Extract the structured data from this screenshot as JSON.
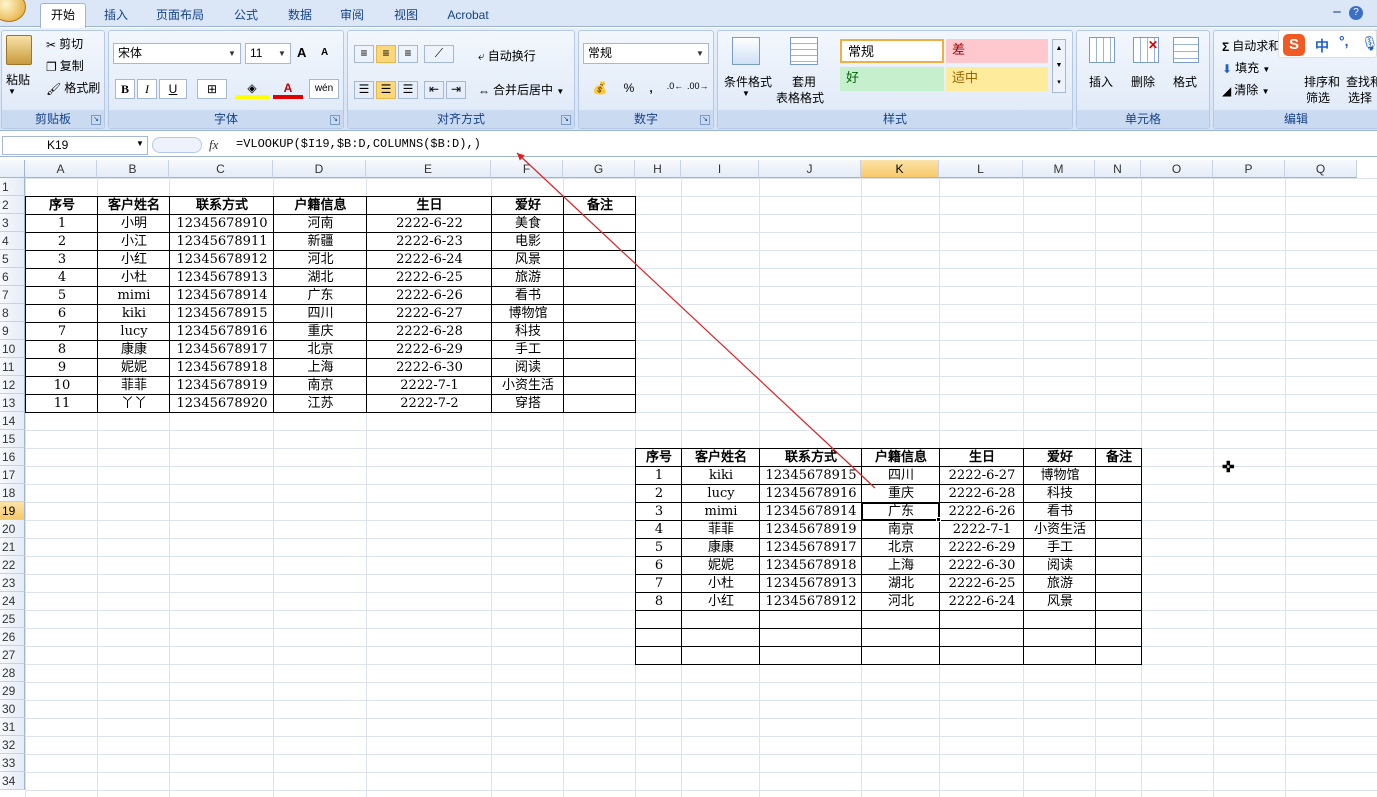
{
  "tabs": [
    "开始",
    "插入",
    "页面布局",
    "公式",
    "数据",
    "审阅",
    "视图",
    "Acrobat"
  ],
  "clipboard": {
    "paste": "粘贴",
    "cut": "剪切",
    "copy": "复制",
    "format_painter": "格式刷",
    "label": "剪贴板"
  },
  "font": {
    "name": "宋体",
    "size": "11",
    "bold": "B",
    "italic": "I",
    "underline": "U",
    "label": "字体",
    "inc": "A",
    "dec": "A",
    "pinyin": "wén"
  },
  "align": {
    "wrap": "自动换行",
    "merge": "合并后居中",
    "label": "对齐方式"
  },
  "number": {
    "format": "常规",
    "percent": "%",
    "comma": ",",
    "label": "数字"
  },
  "styles": {
    "cond": "条件格式",
    "table_fmt1": "套用",
    "table_fmt2": "表格格式",
    "normal": "常规",
    "bad": "差",
    "good": "好",
    "neutral": "适中",
    "label": "样式"
  },
  "cells": {
    "insert": "插入",
    "delete": "删除",
    "format": "格式",
    "label": "单元格"
  },
  "edit": {
    "autosum": "自动求和",
    "fill": "填充",
    "clear": "清除",
    "sort1": "排序和",
    "sort2": "筛选",
    "find1": "查找和",
    "find2": "选择",
    "label": "编辑"
  },
  "ime": {
    "zh": "中"
  },
  "namebox": "K19",
  "formula": "=VLOOKUP($I19,$B:D,COLUMNS($B:D),)",
  "columns": [
    "A",
    "B",
    "C",
    "D",
    "E",
    "F",
    "G",
    "H",
    "I",
    "J",
    "K",
    "L",
    "M",
    "N",
    "O",
    "P",
    "Q"
  ],
  "rows": [
    "1",
    "2",
    "3",
    "4",
    "5",
    "6",
    "7",
    "8",
    "9",
    "10",
    "11",
    "12",
    "13",
    "14",
    "15",
    "16",
    "17",
    "18",
    "19",
    "20",
    "21",
    "22",
    "23",
    "24",
    "25",
    "26",
    "27",
    "28",
    "29",
    "30",
    "31",
    "32",
    "33",
    "34"
  ],
  "table1": {
    "headers": [
      "序号",
      "客户姓名",
      "联系方式",
      "户籍信息",
      "生日",
      "爱好",
      "备注"
    ],
    "rows": [
      [
        "1",
        "小明",
        "12345678910",
        "河南",
        "2222-6-22",
        "美食",
        ""
      ],
      [
        "2",
        "小江",
        "12345678911",
        "新疆",
        "2222-6-23",
        "电影",
        ""
      ],
      [
        "3",
        "小红",
        "12345678912",
        "河北",
        "2222-6-24",
        "风景",
        ""
      ],
      [
        "4",
        "小杜",
        "12345678913",
        "湖北",
        "2222-6-25",
        "旅游",
        ""
      ],
      [
        "5",
        "mimi",
        "12345678914",
        "广东",
        "2222-6-26",
        "看书",
        ""
      ],
      [
        "6",
        "kiki",
        "12345678915",
        "四川",
        "2222-6-27",
        "博物馆",
        ""
      ],
      [
        "7",
        "lucy",
        "12345678916",
        "重庆",
        "2222-6-28",
        "科技",
        ""
      ],
      [
        "8",
        "康康",
        "12345678917",
        "北京",
        "2222-6-29",
        "手工",
        ""
      ],
      [
        "9",
        "妮妮",
        "12345678918",
        "上海",
        "2222-6-30",
        "阅读",
        ""
      ],
      [
        "10",
        "菲菲",
        "12345678919",
        "南京",
        "2222-7-1",
        "小资生活",
        ""
      ],
      [
        "11",
        "丫丫",
        "12345678920",
        "江苏",
        "2222-7-2",
        "穿搭",
        ""
      ]
    ]
  },
  "table2": {
    "headers": [
      "序号",
      "客户姓名",
      "联系方式",
      "户籍信息",
      "生日",
      "爱好",
      "备注"
    ],
    "rows": [
      [
        "1",
        "kiki",
        "12345678915",
        "四川",
        "2222-6-27",
        "博物馆",
        ""
      ],
      [
        "2",
        "lucy",
        "12345678916",
        "重庆",
        "2222-6-28",
        "科技",
        ""
      ],
      [
        "3",
        "mimi",
        "12345678914",
        "广东",
        "2222-6-26",
        "看书",
        ""
      ],
      [
        "4",
        "菲菲",
        "12345678919",
        "南京",
        "2222-7-1",
        "小资生活",
        ""
      ],
      [
        "5",
        "康康",
        "12345678917",
        "北京",
        "2222-6-29",
        "手工",
        ""
      ],
      [
        "6",
        "妮妮",
        "12345678918",
        "上海",
        "2222-6-30",
        "阅读",
        ""
      ],
      [
        "7",
        "小杜",
        "12345678913",
        "湖北",
        "2222-6-25",
        "旅游",
        ""
      ],
      [
        "8",
        "小红",
        "12345678912",
        "河北",
        "2222-6-24",
        "风景",
        ""
      ],
      [
        "",
        "",
        "",
        "",
        "",
        "",
        ""
      ],
      [
        "",
        "",
        "",
        "",
        "",
        "",
        ""
      ],
      [
        "",
        "",
        "",
        "",
        "",
        "",
        ""
      ]
    ]
  },
  "colors": {
    "accent": "#15428b",
    "arrow": "#e02020",
    "selected_header": "#f7c96a"
  }
}
